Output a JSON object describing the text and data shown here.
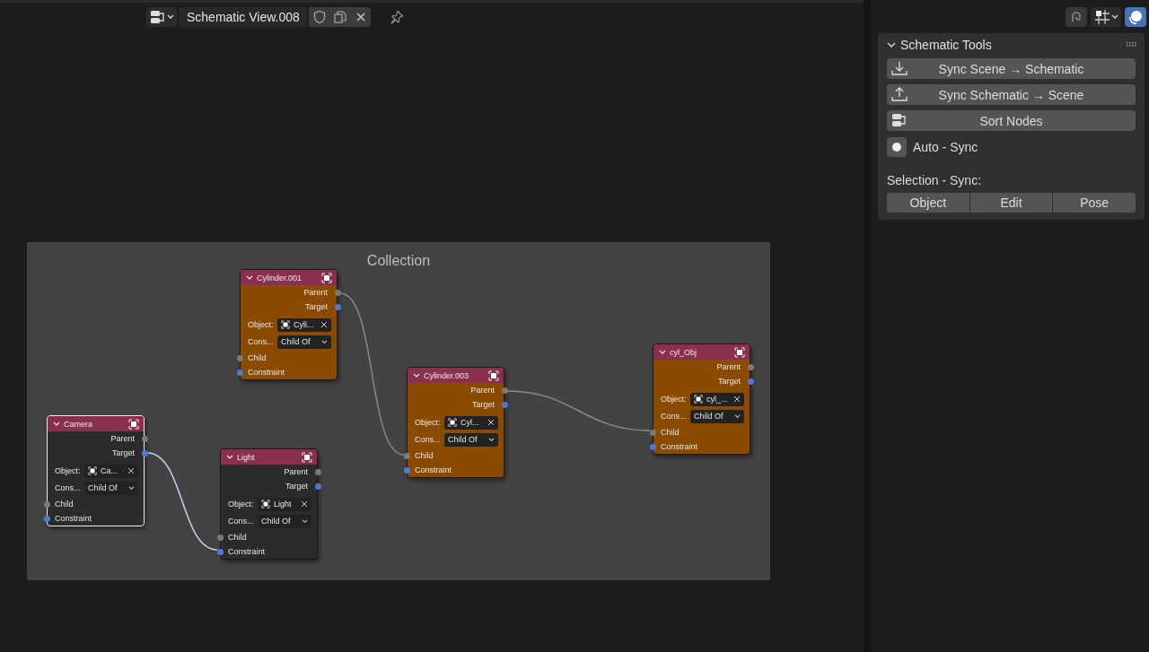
{
  "header": {
    "editor_title": "Schematic View.008"
  },
  "frame": {
    "label": "Collection"
  },
  "nodes": [
    {
      "title": "Cylinder.001",
      "color": "#8a4a00",
      "selected": false,
      "outputs": [
        {
          "label": "Parent",
          "color": "#7a7a7a"
        },
        {
          "label": "Target",
          "color": "#5078d8"
        }
      ],
      "object_label": "Object:",
      "object_value": "Cyli...",
      "constraint_label": "Cons...",
      "constraint_value": "Child Of",
      "inputs": [
        {
          "label": "Child",
          "color": "#7a7a7a"
        },
        {
          "label": "Constraint",
          "color": "#5078d8"
        }
      ]
    },
    {
      "title": "Camera",
      "color": "#2b2b2b",
      "selected": true,
      "outputs": [
        {
          "label": "Parent",
          "color": "#7a7a7a"
        },
        {
          "label": "Target",
          "color": "#5078d8"
        }
      ],
      "object_label": "Object:",
      "object_value": "Ca...",
      "constraint_label": "Cons...",
      "constraint_value": "Child Of",
      "inputs": [
        {
          "label": "Child",
          "color": "#7a7a7a"
        },
        {
          "label": "Constraint",
          "color": "#5078d8"
        }
      ]
    },
    {
      "title": "Light",
      "color": "#2b2b2b",
      "selected": false,
      "outputs": [
        {
          "label": "Parent",
          "color": "#7a7a7a"
        },
        {
          "label": "Target",
          "color": "#5078d8"
        }
      ],
      "object_label": "Object:",
      "object_value": "Light",
      "constraint_label": "Cons...",
      "constraint_value": "Child Of",
      "inputs": [
        {
          "label": "Child",
          "color": "#7a7a7a"
        },
        {
          "label": "Constraint",
          "color": "#5078d8"
        }
      ]
    },
    {
      "title": "Cylinder.003",
      "color": "#8a4a00",
      "selected": false,
      "outputs": [
        {
          "label": "Parent",
          "color": "#7a7a7a"
        },
        {
          "label": "Target",
          "color": "#5078d8"
        }
      ],
      "object_label": "Object:",
      "object_value": "Cyl...",
      "constraint_label": "Cons...",
      "constraint_value": "Child Of",
      "inputs": [
        {
          "label": "Child",
          "color": "#7a7a7a"
        },
        {
          "label": "Constraint",
          "color": "#5078d8"
        }
      ]
    },
    {
      "title": "cyl_Obj",
      "color": "#8a4a00",
      "selected": false,
      "outputs": [
        {
          "label": "Parent",
          "color": "#7a7a7a"
        },
        {
          "label": "Target",
          "color": "#5078d8"
        }
      ],
      "object_label": "Object:",
      "object_value": "cyl_...",
      "constraint_label": "Cons...",
      "constraint_value": "Child Of",
      "inputs": [
        {
          "label": "Child",
          "color": "#7a7a7a"
        },
        {
          "label": "Constraint",
          "color": "#5078d8"
        }
      ]
    }
  ],
  "panel": {
    "title": "Schematic Tools",
    "expanded": true,
    "buttons": [
      {
        "label": "Sync Scene → Schematic",
        "kind": "download"
      },
      {
        "label": "Sync Schematic → Scene",
        "kind": "upload"
      },
      {
        "label": "Sort Nodes",
        "kind": "sort"
      }
    ],
    "auto_sync": {
      "label": "Auto - Sync",
      "checked": true
    },
    "selection_sync": {
      "label": "Selection - Sync:",
      "options": [
        {
          "label": "Object",
          "selected": false
        },
        {
          "label": "Edit",
          "selected": false
        },
        {
          "label": "Pose",
          "selected": false
        }
      ]
    }
  }
}
